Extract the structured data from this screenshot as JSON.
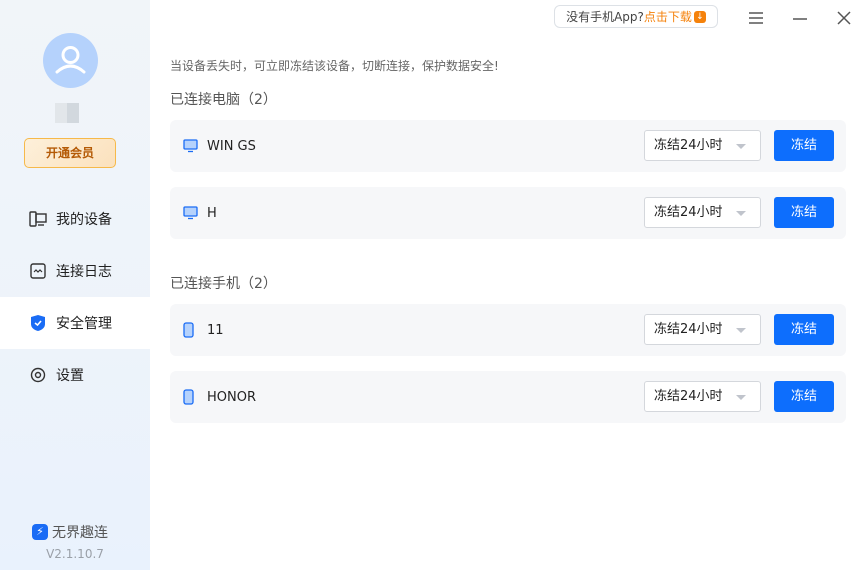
{
  "sidebar": {
    "vip_label": "开通会员",
    "items": [
      {
        "label": "我的设备",
        "icon": "devices-icon"
      },
      {
        "label": "连接日志",
        "icon": "log-icon"
      },
      {
        "label": "安全管理",
        "icon": "shield-icon",
        "active": true
      },
      {
        "label": "设置",
        "icon": "settings-icon"
      }
    ],
    "brand": "无界趣连",
    "version": "V2.1.10.7"
  },
  "header": {
    "promo_text": "没有手机App?",
    "promo_link": "点击下载"
  },
  "main": {
    "tip": "当设备丢失时，可立即冻结该设备，切断连接，保护数据安全!",
    "computers": {
      "title": "已连接电脑（2）",
      "devices": [
        {
          "name": "WIN GS",
          "duration": "冻结24小时",
          "action": "冻结"
        },
        {
          "name": "H",
          "duration": "冻结24小时",
          "action": "冻结"
        }
      ]
    },
    "phones": {
      "title": "已连接手机（2）",
      "devices": [
        {
          "name": "11",
          "duration": "冻结24小时",
          "action": "冻结"
        },
        {
          "name": "HONOR",
          "duration": "冻结24小时",
          "action": "冻结"
        }
      ]
    }
  },
  "colors": {
    "accent": "#0d6efd",
    "download": "#f5820b",
    "vip": "#b45a06"
  }
}
